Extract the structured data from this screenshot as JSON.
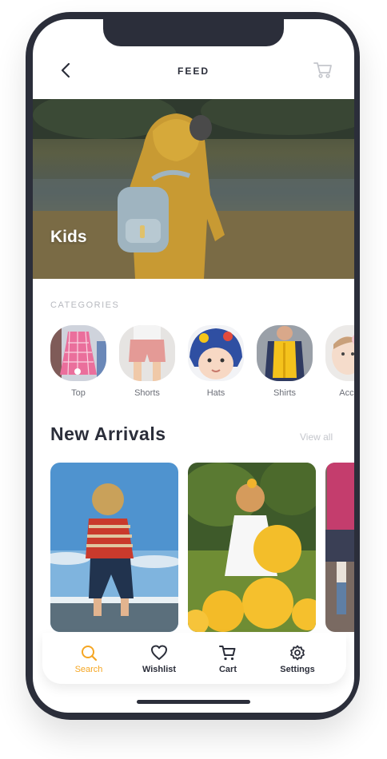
{
  "header": {
    "title": "FEED"
  },
  "hero": {
    "label": "Kids"
  },
  "categories": {
    "title": "CATEGORIES",
    "items": [
      {
        "label": "Top"
      },
      {
        "label": "Shorts"
      },
      {
        "label": "Hats"
      },
      {
        "label": "Shirts"
      },
      {
        "label": "Access"
      }
    ]
  },
  "arrivals": {
    "title": "New Arrivals",
    "view_all": "View all"
  },
  "tabs": [
    {
      "label": "Search",
      "icon": "search-icon"
    },
    {
      "label": "Wishlist",
      "icon": "heart-icon"
    },
    {
      "label": "Cart",
      "icon": "cart-icon"
    },
    {
      "label": "Settings",
      "icon": "gear-icon"
    }
  ],
  "colors": {
    "accent": "#f5a623",
    "ink": "#2b2e3a"
  }
}
